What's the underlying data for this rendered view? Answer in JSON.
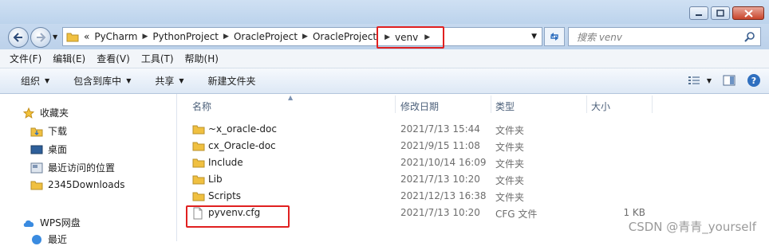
{
  "address": {
    "overflow": "«",
    "crumbs": [
      "PyCharm",
      "PythonProject",
      "OracleProject",
      "OracleProject",
      "venv"
    ]
  },
  "search": {
    "placeholder": "搜索 venv"
  },
  "menu": [
    "文件(F)",
    "编辑(E)",
    "查看(V)",
    "工具(T)",
    "帮助(H)"
  ],
  "toolbar": {
    "organize": "组织",
    "include_library": "包含到库中",
    "share": "共享",
    "new_folder": "新建文件夹"
  },
  "sidebar": {
    "favorites": "收藏夹",
    "items": [
      "下载",
      "桌面",
      "最近访问的位置",
      "2345Downloads"
    ],
    "wps": "WPS网盘",
    "recent": "最近"
  },
  "columns": {
    "name": "名称",
    "date": "修改日期",
    "type": "类型",
    "size": "大小"
  },
  "files": [
    {
      "name": "~x_oracle-doc",
      "date": "2021/7/13 15:44",
      "type": "文件夹",
      "size": "",
      "kind": "folder"
    },
    {
      "name": "cx_Oracle-doc",
      "date": "2021/9/15 11:08",
      "type": "文件夹",
      "size": "",
      "kind": "folder"
    },
    {
      "name": "Include",
      "date": "2021/10/14 16:09",
      "type": "文件夹",
      "size": "",
      "kind": "folder"
    },
    {
      "name": "Lib",
      "date": "2021/7/13 10:20",
      "type": "文件夹",
      "size": "",
      "kind": "folder"
    },
    {
      "name": "Scripts",
      "date": "2021/12/13 16:38",
      "type": "文件夹",
      "size": "",
      "kind": "folder"
    },
    {
      "name": "pyvenv.cfg",
      "date": "2021/7/13 10:20",
      "type": "CFG 文件",
      "size": "1 KB",
      "kind": "file"
    }
  ],
  "watermark": "CSDN @青青_yourself",
  "colors": {
    "highlight": "#e02020",
    "folder": "#f0c040",
    "chrome": "#c6d9ef"
  }
}
